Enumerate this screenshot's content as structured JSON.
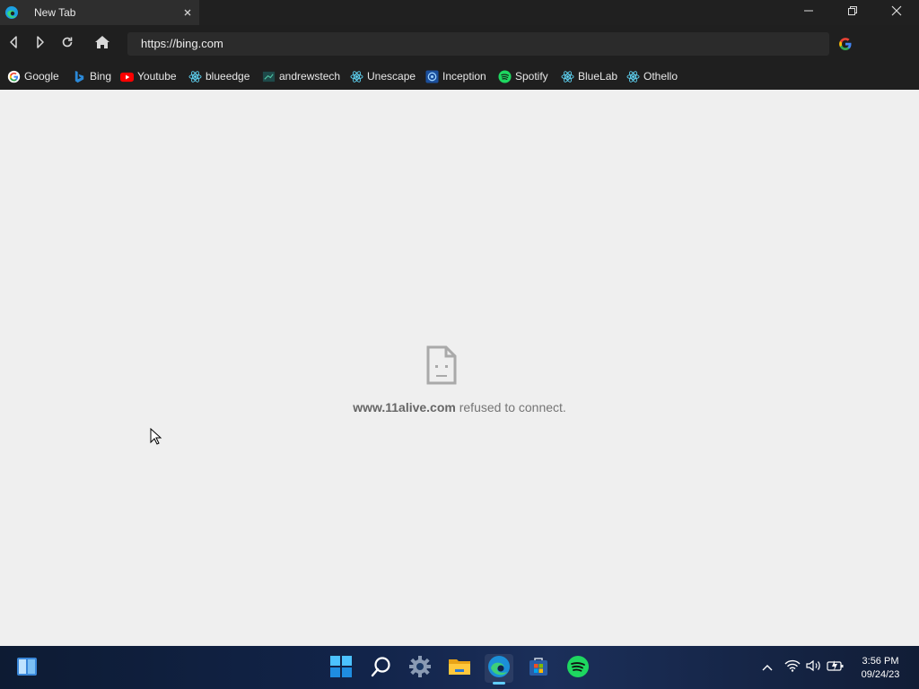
{
  "window": {
    "tab_title": "New Tab",
    "icons": {
      "tab": "edge-icon",
      "close_tab": "close-icon",
      "minimize": "minimize-icon",
      "restore": "restore-icon",
      "close": "close-icon"
    }
  },
  "toolbar": {
    "url": "https://bing.com",
    "buttons": [
      "back-icon",
      "forward-icon",
      "reload-icon",
      "home-icon"
    ],
    "search_engine_icon": "google-icon"
  },
  "bookmarks": [
    {
      "label": "Google",
      "icon": "google-icon"
    },
    {
      "label": "Bing",
      "icon": "bing-icon"
    },
    {
      "label": "Youtube",
      "icon": "youtube-icon"
    },
    {
      "label": "blueedge",
      "icon": "react-icon"
    },
    {
      "label": "andrewstech",
      "icon": "andrewstech-icon"
    },
    {
      "label": "Unescape",
      "icon": "react-icon"
    },
    {
      "label": "Inception",
      "icon": "inception-icon"
    },
    {
      "label": "Spotify",
      "icon": "spotify-icon"
    },
    {
      "label": "BlueLab",
      "icon": "react-icon"
    },
    {
      "label": "Othello",
      "icon": "react-icon"
    }
  ],
  "error": {
    "host": "www.11alive.com",
    "message": "refused to connect.",
    "icon": "sad-document-icon"
  },
  "taskbar": {
    "apps": [
      "widgets-icon",
      "start-icon",
      "search-icon",
      "settings-icon",
      "file-explorer-icon",
      "edge-icon",
      "store-icon",
      "spotify-icon"
    ],
    "tray": [
      "chevron-up-icon",
      "wifi-icon",
      "volume-icon",
      "battery-icon"
    ],
    "time": "3:56 PM",
    "date": "09/24/23"
  },
  "colors": {
    "titlebar": "#202020",
    "toolbar": "#1f1f1f",
    "content": "#efefef",
    "spotify": "#1ed760",
    "react": "#61dafb",
    "accent": "#60cdff"
  }
}
